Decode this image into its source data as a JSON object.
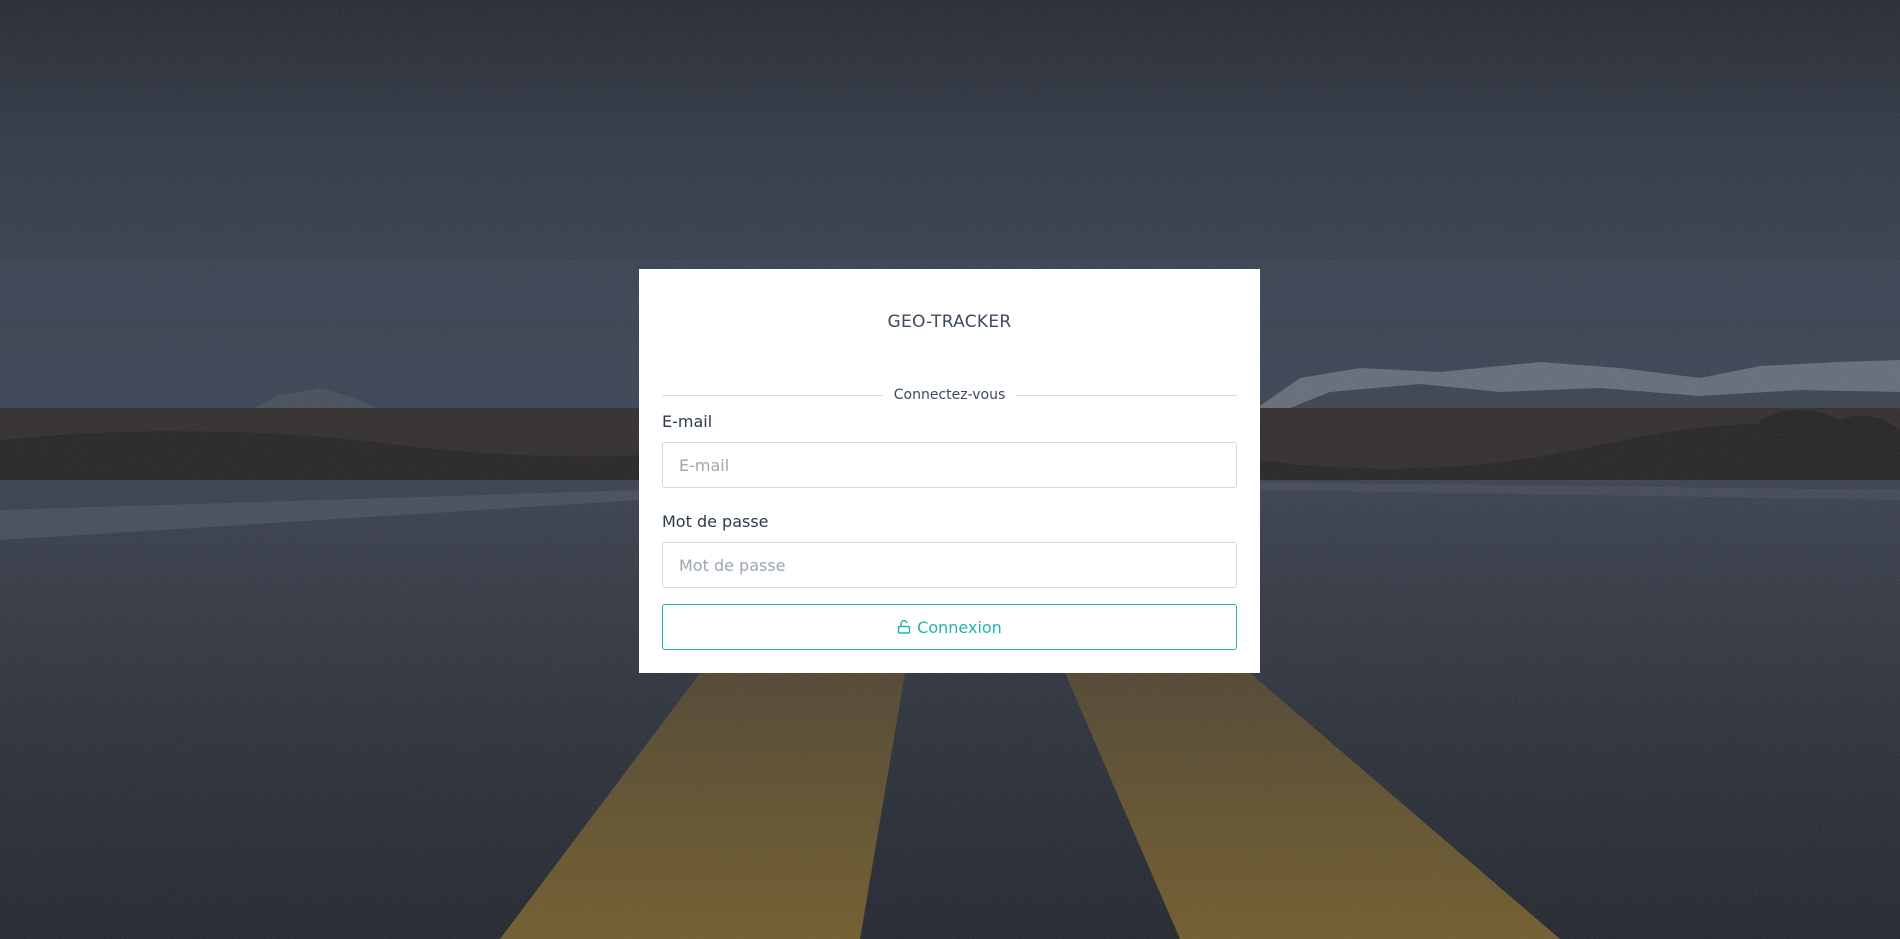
{
  "app": {
    "title": "GEO-TRACKER"
  },
  "login": {
    "subtitle": "Connectez-vous",
    "email": {
      "label": "E-mail",
      "placeholder": "E-mail",
      "value": ""
    },
    "password": {
      "label": "Mot de passe",
      "placeholder": "Mot de passe",
      "value": ""
    },
    "submit_label": "Connexion",
    "submit_icon": "lock-open-icon"
  },
  "colors": {
    "accent": "#1fb5ad",
    "text": "#3c4a5c",
    "card": "#ffffff"
  }
}
